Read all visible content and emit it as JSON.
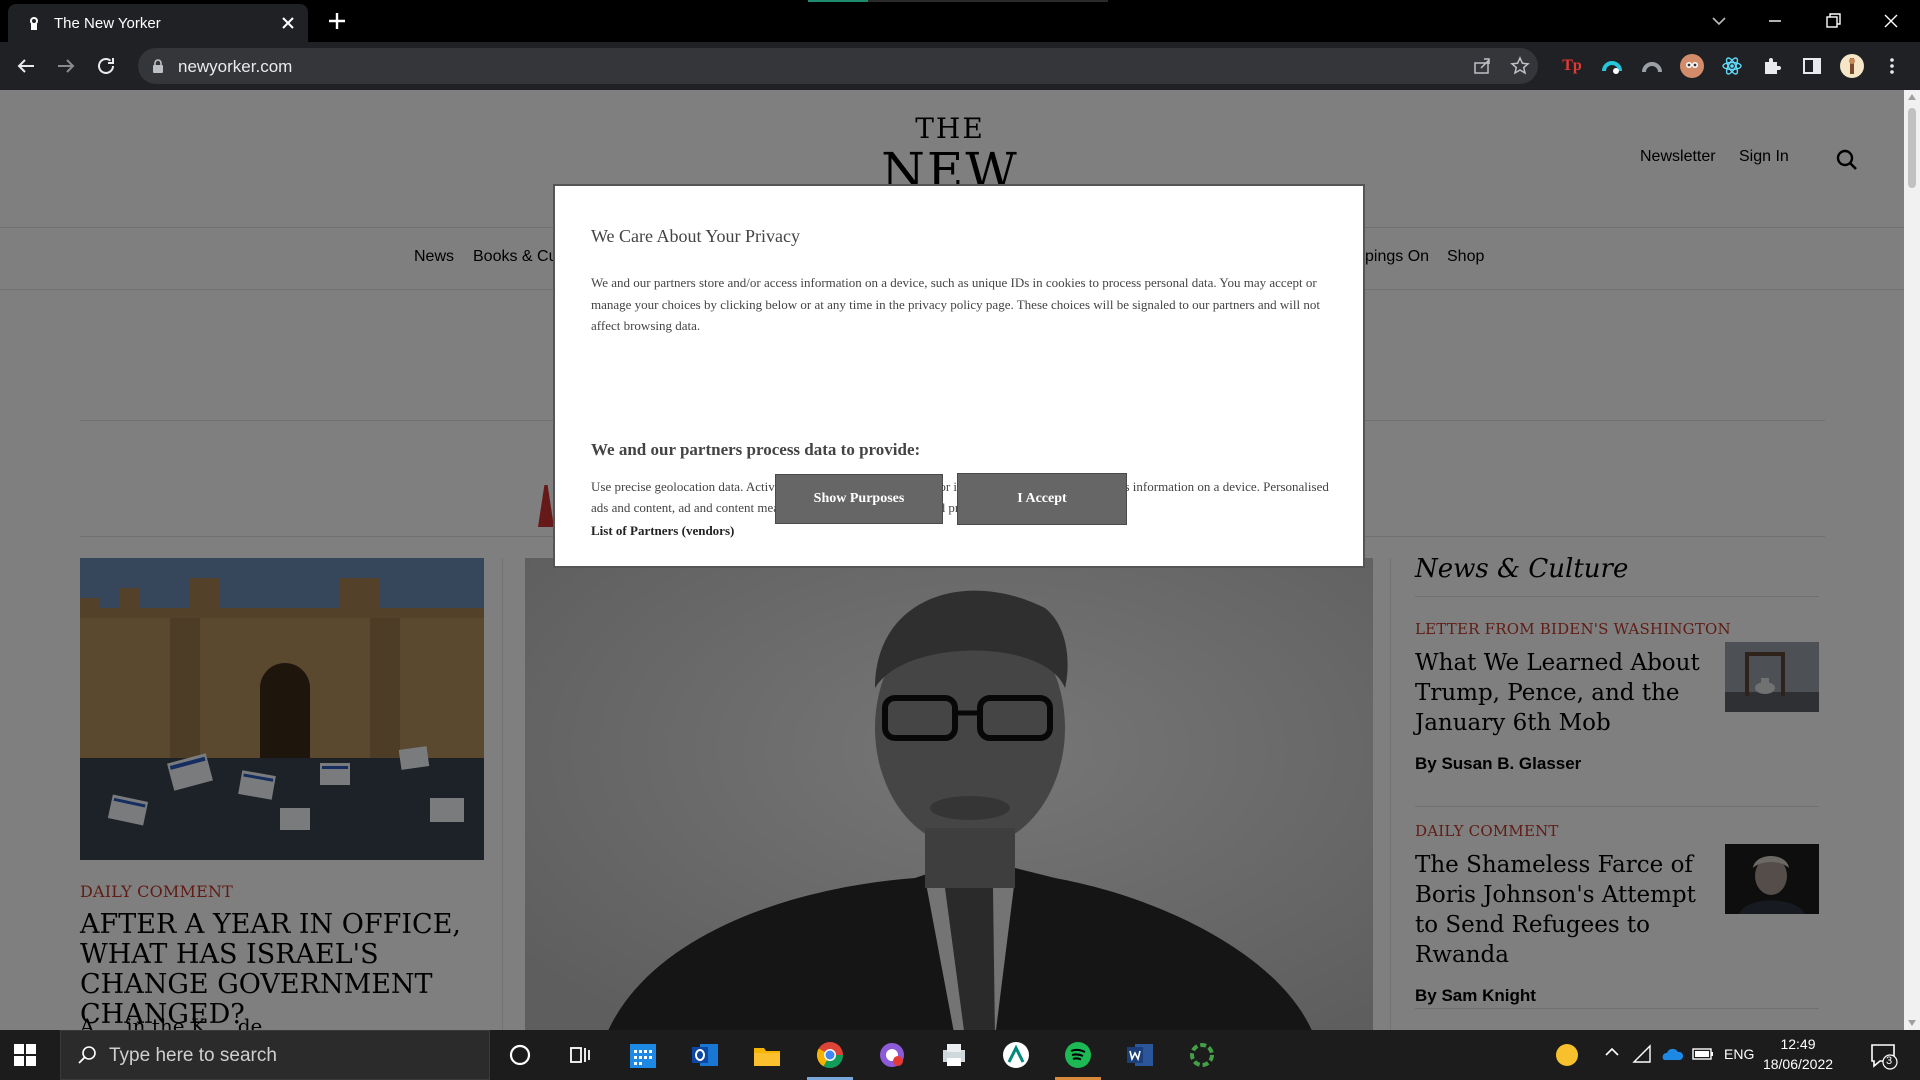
{
  "browser": {
    "tab_title": "The New Yorker",
    "url": "newyorker.com"
  },
  "site": {
    "logo_line1": "THE",
    "logo_line2": "NEW YORKER",
    "header_links": [
      "Newsletter",
      "Sign In"
    ],
    "nav": [
      "News",
      "Books & Cu",
      "pings On",
      "Shop"
    ]
  },
  "left_story": {
    "kicker": "DAILY COMMENT",
    "headline": "AFTER A YEAR IN OFFICE, WHAT HAS ISRAEL'S CHANGE GOVERNMENT CHANGED?",
    "dek": "A ... in the K ... de ..."
  },
  "rail": {
    "title": "News & Culture",
    "stories": [
      {
        "kicker": "LETTER FROM BIDEN'S WASHINGTON",
        "headline": "What We Learned About Trump, Pence, and the January 6th Mob",
        "byline": "By Susan B. Glasser"
      },
      {
        "kicker": "DAILY COMMENT",
        "headline": "The Shameless Farce of Boris Johnson's Attempt to Send Refugees to Rwanda",
        "byline": "By Sam Knight"
      }
    ]
  },
  "consent": {
    "title": "We Care About Your Privacy",
    "body": "We and our partners store and/or access information on a device, such as unique IDs in cookies to process personal data. You may accept or manage your choices by clicking below or at any time in the privacy policy page. These choices will be signaled to our partners and will not affect browsing data.",
    "subtitle": "We and our partners process data to provide:",
    "purposes": "Use precise geolocation data. Actively scan device characteristics for identification. Store and/or access information on a device. Personalised ads and content, ad and content measurement, audience insights and product development.",
    "partners_link": "List of Partners (vendors)",
    "show_purposes": "Show Purposes",
    "accept": "I Accept"
  },
  "taskbar": {
    "search_placeholder": "Type here to search",
    "language": "ENG",
    "time": "12:49",
    "date": "18/06/2022",
    "notifications": "3"
  }
}
